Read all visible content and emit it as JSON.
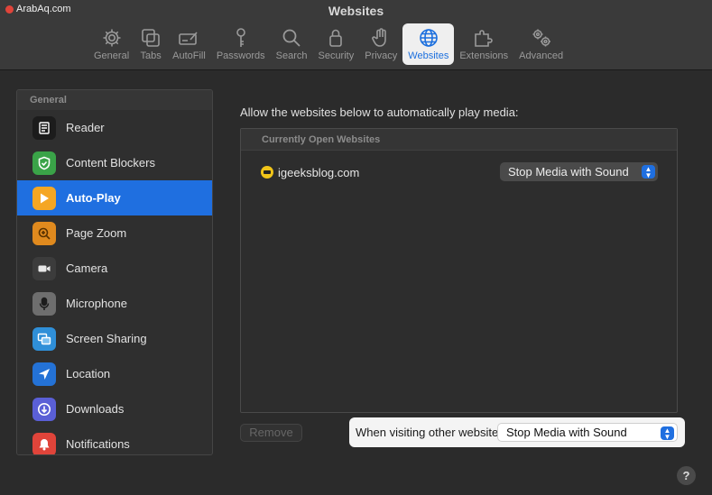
{
  "window": {
    "title": "Websites",
    "watermark": "ArabAq.com"
  },
  "toolbar": {
    "tabs": [
      {
        "label": "General",
        "icon": "gear-icon"
      },
      {
        "label": "Tabs",
        "icon": "tabs-icon"
      },
      {
        "label": "AutoFill",
        "icon": "autofill-icon"
      },
      {
        "label": "Passwords",
        "icon": "key-icon"
      },
      {
        "label": "Search",
        "icon": "search-icon"
      },
      {
        "label": "Security",
        "icon": "lock-icon"
      },
      {
        "label": "Privacy",
        "icon": "hand-icon"
      },
      {
        "label": "Websites",
        "icon": "globe-icon",
        "active": true
      },
      {
        "label": "Extensions",
        "icon": "extensions-icon"
      },
      {
        "label": "Advanced",
        "icon": "gears-icon"
      }
    ]
  },
  "sidebar": {
    "section": "General",
    "items": [
      {
        "label": "Reader",
        "icon": "reader-icon",
        "color": "#1c1c1c"
      },
      {
        "label": "Content Blockers",
        "icon": "shield-icon",
        "color": "#3aa348"
      },
      {
        "label": "Auto-Play",
        "icon": "play-icon",
        "color": "#f5a623",
        "active": true
      },
      {
        "label": "Page Zoom",
        "icon": "zoom-icon",
        "color": "#e08a1e"
      },
      {
        "label": "Camera",
        "icon": "camera-icon",
        "color": "#3c3c3c"
      },
      {
        "label": "Microphone",
        "icon": "microphone-icon",
        "color": "#6e6e6e"
      },
      {
        "label": "Screen Sharing",
        "icon": "screen-sharing-icon",
        "color": "#2f8fd8"
      },
      {
        "label": "Location",
        "icon": "location-icon",
        "color": "#2472d6"
      },
      {
        "label": "Downloads",
        "icon": "download-icon",
        "color": "#5a5fd6"
      },
      {
        "label": "Notifications",
        "icon": "bell-icon",
        "color": "#e0443a"
      }
    ]
  },
  "main": {
    "description": "Allow the websites below to automatically play media:",
    "open_websites_header": "Currently Open Websites",
    "sites": [
      {
        "name": "igeeksblog.com",
        "setting": "Stop Media with Sound"
      }
    ],
    "remove_label": "Remove",
    "other_websites_label": "When visiting other websites:",
    "other_websites_setting": "Stop Media with Sound",
    "help_label": "?"
  },
  "colors": {
    "accent": "#1f6fe0",
    "highlight_panel": "#f4f4f4"
  }
}
